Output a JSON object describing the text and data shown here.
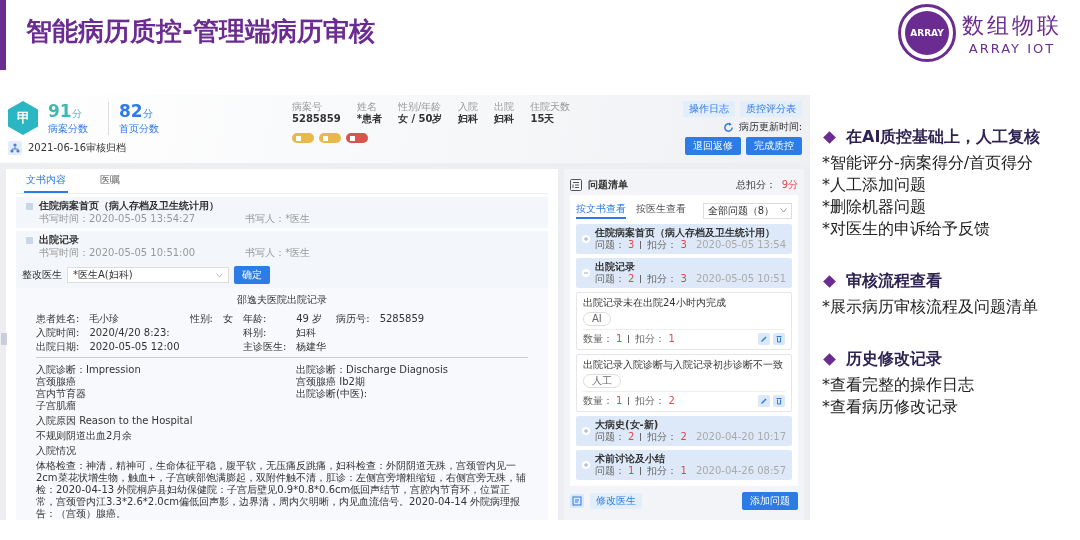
{
  "slide": {
    "title": "智能病历质控-管理端病历审核",
    "logo": {
      "mark": "ARRAY",
      "name": "数组物联",
      "subtitle": "ARRAY IOT"
    }
  },
  "case": {
    "grade": "甲",
    "scores": [
      {
        "value": "91",
        "unit": "分",
        "label": "病案分数"
      },
      {
        "value": "82",
        "unit": "分",
        "label": "首页分数"
      }
    ],
    "archive_note": "2021-06-16审核归档",
    "patient": [
      {
        "label": "病案号",
        "value": "5285859"
      },
      {
        "label": "姓名",
        "value": "*患者"
      },
      {
        "label": "性别/年龄",
        "value": "女 / 50岁"
      },
      {
        "label": "入院",
        "value": "妇科"
      },
      {
        "label": "出院",
        "value": "妇科"
      },
      {
        "label": "住院天数",
        "value": "15天"
      }
    ],
    "tags": [
      {
        "color": "#e8b84a"
      },
      {
        "color": "#e8b84a"
      },
      {
        "color": "#d9534f"
      }
    ],
    "top_buttons": [
      "操作日志",
      "质控评分表"
    ],
    "update_label": "病历更新时间:",
    "actions": [
      "退回返修",
      "完成质控"
    ]
  },
  "document_panel": {
    "tabs": [
      {
        "label": "文书内容",
        "selected": true
      },
      {
        "label": "医嘱",
        "selected": false
      }
    ],
    "records": [
      {
        "title": "住院病案首页（病人存档及卫生统计用）",
        "time": "书写时间：2020-05-05 13:54:27",
        "writer": "书写人：*医生"
      },
      {
        "title": "出院记录",
        "time": "书写时间：2020-05-05 10:51:00",
        "writer": "书写人：*医生"
      }
    ],
    "doctor_field": {
      "label": "整改医生",
      "value": "*医生A(妇科)"
    },
    "confirm_button": "确定",
    "document": {
      "title": "邵逸夫医院出院记录",
      "info_rows": [
        [
          {
            "label": "患者姓名:",
            "value": "毛小珍"
          },
          {
            "label": "性别:",
            "value": "女"
          },
          {
            "label": "年龄:",
            "value": "49 岁"
          },
          {
            "label": "病历号:",
            "value": "5285859"
          }
        ],
        [
          {
            "label": "入院时间:",
            "value": "2020/4/20 8:23:"
          },
          {
            "label": "科别:",
            "value": "妇科"
          }
        ],
        [
          {
            "label": "出院日期:",
            "value": "2020-05-05 12:00"
          },
          {
            "label": "主诊医生:",
            "value": "杨建华"
          }
        ]
      ],
      "diagnosis_left": [
        "入院诊断：Impression",
        "宫颈腺癌",
        "宫内节育器",
        "子宫肌瘤"
      ],
      "diagnosis_right": [
        "出院诊断：Discharge Diagnosis",
        "宫颈腺癌 Ib2期",
        "出院诊断(中医):"
      ],
      "sections": [
        "入院原因 Reason to the Hospital",
        "不规则阴道出血2月余",
        "入院情况"
      ],
      "exam": "体格检查：神清，精神可，生命体征平稳，腹平软，无压痛反跳痛，妇科检查：外阴阴道无殊，宫颈管内见一2cm菜花状增生物，触血+，子宫峡部饱满膨起，双附件触不清，肛诊：左侧宫旁增粗缩短，右侧宫旁无殊，辅检：2020-04-13 外院桐庐县妇幼保健院：子宫后壁见0.9*0.8*0.6cm低回声结节，宫腔内节育环，位置正常，宫颈管内江3.3*2.6*2.0cm偏低回声影，边界清，周内欠明晰，内见血流信号。2020-04-14 外院病理报告：（宫颈）腺癌。"
    }
  },
  "issue_panel": {
    "title": "问题清单",
    "total_label": "总扣分：",
    "total_value": "9分",
    "tabs": [
      {
        "label": "按文书查看",
        "selected": true
      },
      {
        "label": "按医生查看",
        "selected": false
      }
    ],
    "filter": "全部问题（8）",
    "groups": [
      {
        "title": "住院病案首页（病人存档及卫生统计用）",
        "meta": [
          {
            "label": "问题：",
            "value": "3"
          },
          {
            "label": "扣分：",
            "value": "3"
          }
        ],
        "time": "2020-05-05 13:54",
        "expanded": false
      },
      {
        "title": "出院记录",
        "meta": [
          {
            "label": "问题：",
            "value": "2"
          },
          {
            "label": "扣分：",
            "value": "3"
          }
        ],
        "time": "2020-05-05 10:51",
        "expanded": true,
        "issues": [
          {
            "text": "出院记录未在出院24小时内完成",
            "source": "AI",
            "meta": [
              {
                "label": "数量：",
                "value": "1"
              },
              {
                "label": "扣分：",
                "value": "1"
              }
            ]
          },
          {
            "text": "出院记录入院诊断与入院记录初步诊断不一致",
            "source": "人工",
            "meta": [
              {
                "label": "数量：",
                "value": "1"
              },
              {
                "label": "扣分：",
                "value": "2"
              }
            ]
          }
        ]
      },
      {
        "title": "大病史(女-新)",
        "meta": [
          {
            "label": "问题：",
            "value": "2"
          },
          {
            "label": "扣分：",
            "value": "2"
          }
        ],
        "time": "2020-04-20 10:17",
        "expanded": false
      },
      {
        "title": "术前讨论及小结",
        "meta": [
          {
            "label": "问题：",
            "value": "1"
          },
          {
            "label": "扣分：",
            "value": "1"
          }
        ],
        "time": "2020-04-26 08:57",
        "expanded": false
      }
    ],
    "footer_buttons": [
      "修改医生",
      "添加问题"
    ]
  },
  "notes": [
    {
      "heading": "在AI质控基础上，人工复核",
      "items": [
        "*智能评分-病案得分/首页得分",
        "*人工添加问题",
        "*删除机器问题",
        "*对医生的申诉给予反馈"
      ]
    },
    {
      "heading": "审核流程查看",
      "items": [
        "*展示病历审核流程及问题清单"
      ]
    },
    {
      "heading": "历史修改记录",
      "items": [
        "*查看完整的操作日志",
        "*查看病历修改记录"
      ]
    }
  ]
}
